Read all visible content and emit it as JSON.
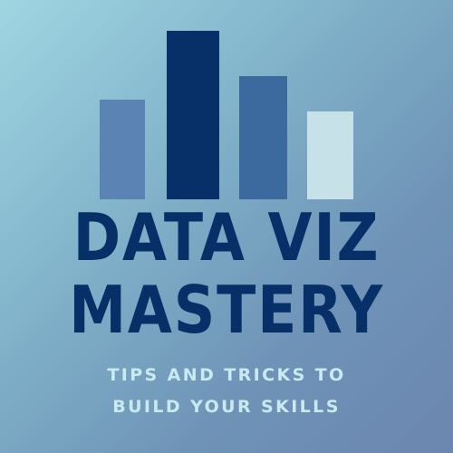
{
  "logo": {
    "title_lines": [
      "DATA VIZ",
      "MASTERY"
    ],
    "subtitle_lines": [
      "TIPS AND TRICKS TO",
      "BUILD YOUR SKILLS"
    ],
    "icon": "bar-chart-icon",
    "bar_levels": [
      0.59,
      1.0,
      0.73,
      0.52
    ],
    "colors": {
      "title": "#063067",
      "subtitle": "#c9eaf0",
      "bars": [
        "#5b84b4",
        "#063067",
        "#3c6a9e",
        "#c6e2e8"
      ],
      "background": [
        "#9fd6e2",
        "#6b86b0"
      ]
    }
  }
}
